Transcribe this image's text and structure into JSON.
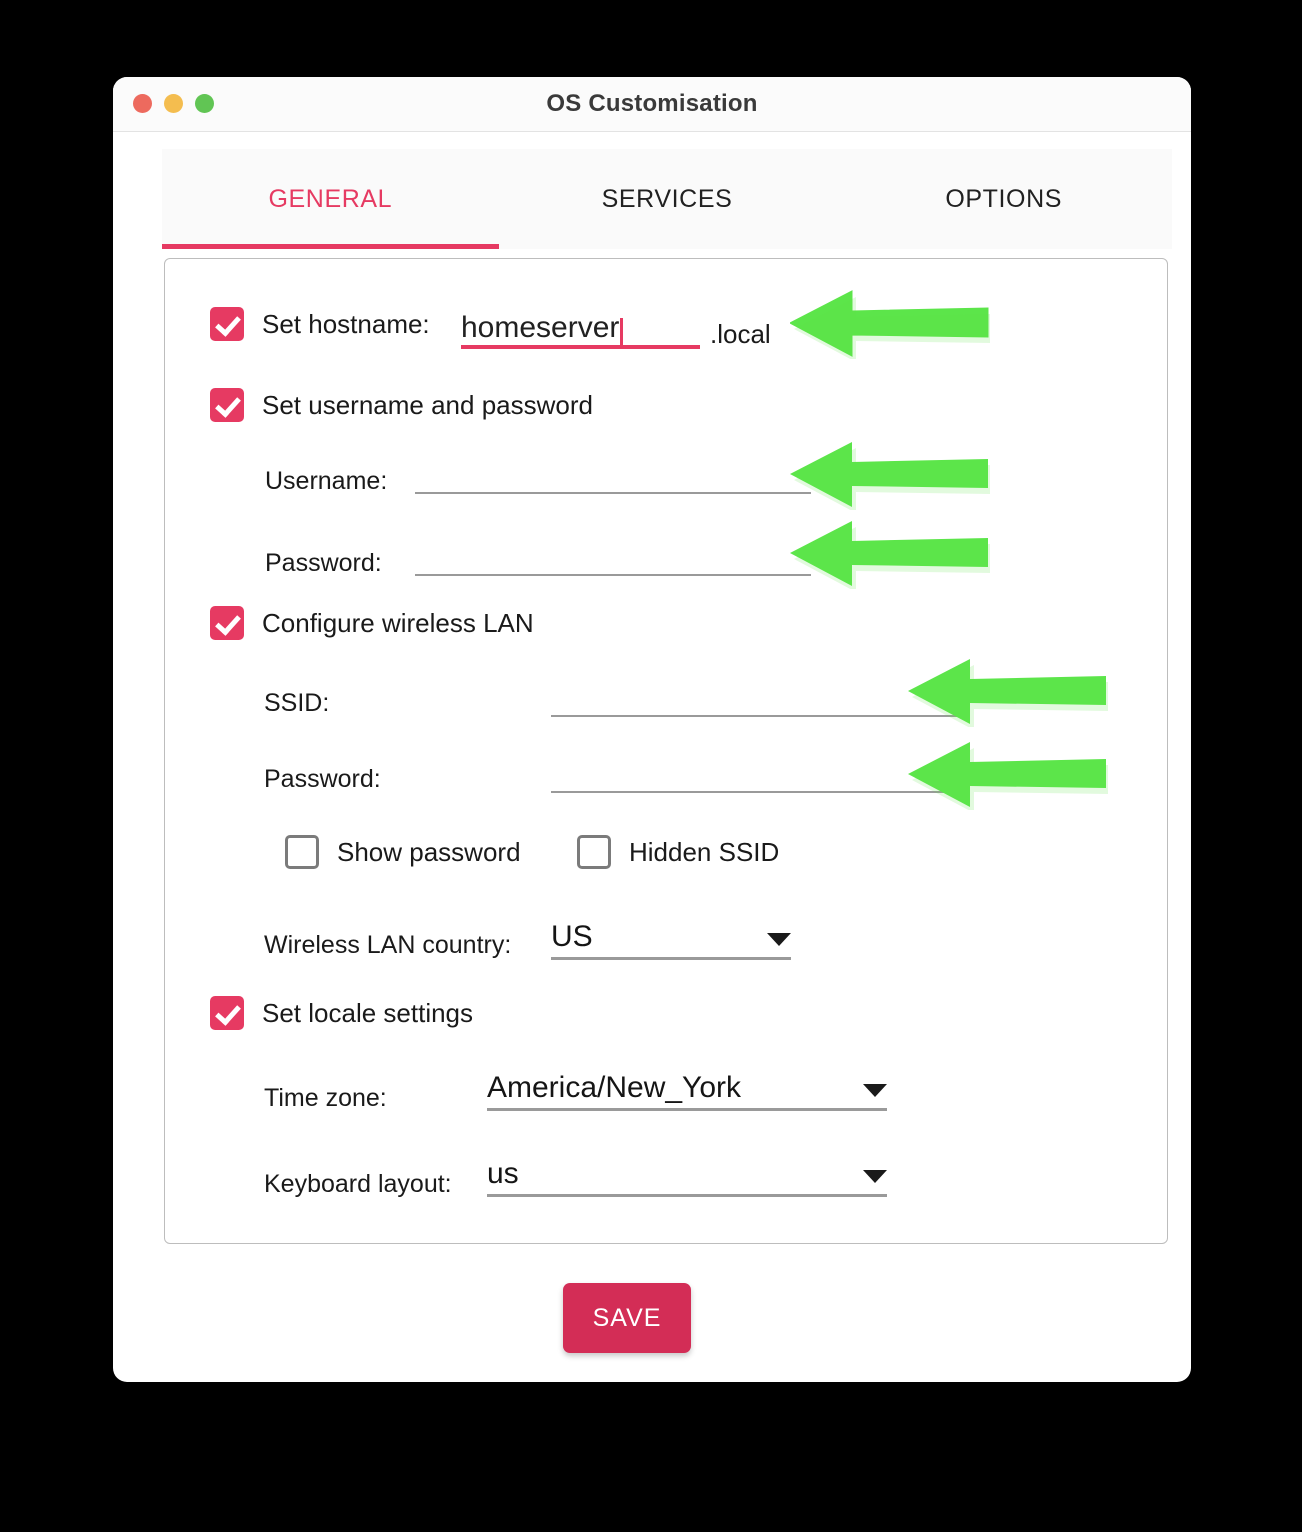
{
  "window": {
    "title": "OS Customisation",
    "traffic_lights": [
      "close-red",
      "minimize-yellow",
      "zoom-green"
    ]
  },
  "tabs": [
    {
      "label": "GENERAL",
      "active": true
    },
    {
      "label": "SERVICES",
      "active": false
    },
    {
      "label": "OPTIONS",
      "active": false
    }
  ],
  "general": {
    "hostname": {
      "checkbox_checked": true,
      "label": "Set hostname:",
      "value": "homeserver",
      "suffix": ".local"
    },
    "user": {
      "checkbox_checked": true,
      "label": "Set username and password",
      "username_label": "Username:",
      "username_value": "",
      "password_label": "Password:",
      "password_value": ""
    },
    "wlan": {
      "checkbox_checked": true,
      "label": "Configure wireless LAN",
      "ssid_label": "SSID:",
      "ssid_value": "",
      "password_label": "Password:",
      "password_value": "",
      "show_password_label": "Show password",
      "show_password_checked": false,
      "hidden_ssid_label": "Hidden SSID",
      "hidden_ssid_checked": false,
      "country_label": "Wireless LAN country:",
      "country_value": "US"
    },
    "locale": {
      "checkbox_checked": true,
      "label": "Set locale settings",
      "timezone_label": "Time zone:",
      "timezone_value": "America/New_York",
      "keyboard_label": "Keyboard layout:",
      "keyboard_value": "us"
    }
  },
  "footer": {
    "save_label": "SAVE"
  },
  "annotations": {
    "arrow_color": "#5ce54a",
    "arrows": [
      {
        "name": "arrow-to-hostname-field"
      },
      {
        "name": "arrow-to-username-field"
      },
      {
        "name": "arrow-to-user-password-field"
      },
      {
        "name": "arrow-to-ssid-field"
      },
      {
        "name": "arrow-to-wifi-password-field"
      }
    ]
  },
  "colors": {
    "accent": "#e63a62",
    "save_button": "#d32d56",
    "arrow_green": "#5ce54a",
    "page_background": "#000000"
  }
}
